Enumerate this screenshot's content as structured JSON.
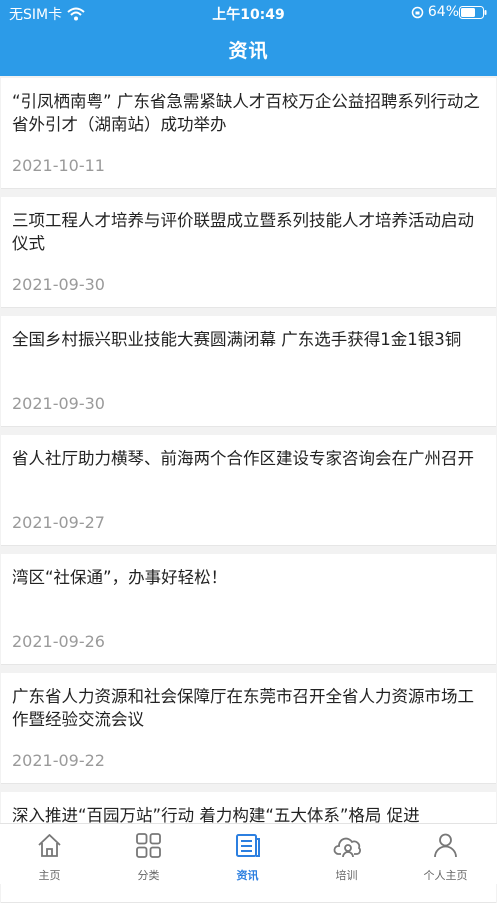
{
  "status_bar": {
    "carrier": "无SIM卡",
    "time": "上午10:49",
    "battery": "64%"
  },
  "header": {
    "title": "资讯"
  },
  "news": [
    {
      "title": "“引凤栖南粤” 广东省急需紧缺人才百校万企公益招聘系列行动之省外引才（湖南站）成功举办",
      "date": "2021-10-11"
    },
    {
      "title": "三项工程人才培养与评价联盟成立暨系列技能人才培养活动启动仪式",
      "date": "2021-09-30"
    },
    {
      "title": "全国乡村振兴职业技能大赛圆满闭幕 广东选手获得1金1银3铜",
      "date": "2021-09-30"
    },
    {
      "title": "省人社厅助力横琴、前海两个合作区建设专家咨询会在广州召开",
      "date": "2021-09-27"
    },
    {
      "title": "湾区“社保通”，办事好轻松！",
      "date": "2021-09-26"
    },
    {
      "title": "广东省人力资源和社会保障厅在东莞市召开全省人力资源市场工作暨经验交流会议",
      "date": "2021-09-22"
    },
    {
      "title": "深入推进“百园万站”行动  着力构建“五大体系”格局  促进",
      "date": ""
    }
  ],
  "tabs": [
    {
      "label": "主页",
      "icon": "home-icon"
    },
    {
      "label": "分类",
      "icon": "grid-icon"
    },
    {
      "label": "资讯",
      "icon": "news-icon",
      "active": true
    },
    {
      "label": "培训",
      "icon": "cloud-person-icon"
    },
    {
      "label": "个人主页",
      "icon": "person-icon"
    }
  ],
  "colors": {
    "primary": "#2c9be8",
    "active_tab": "#2c7fe0",
    "date": "#9a9a9a"
  }
}
